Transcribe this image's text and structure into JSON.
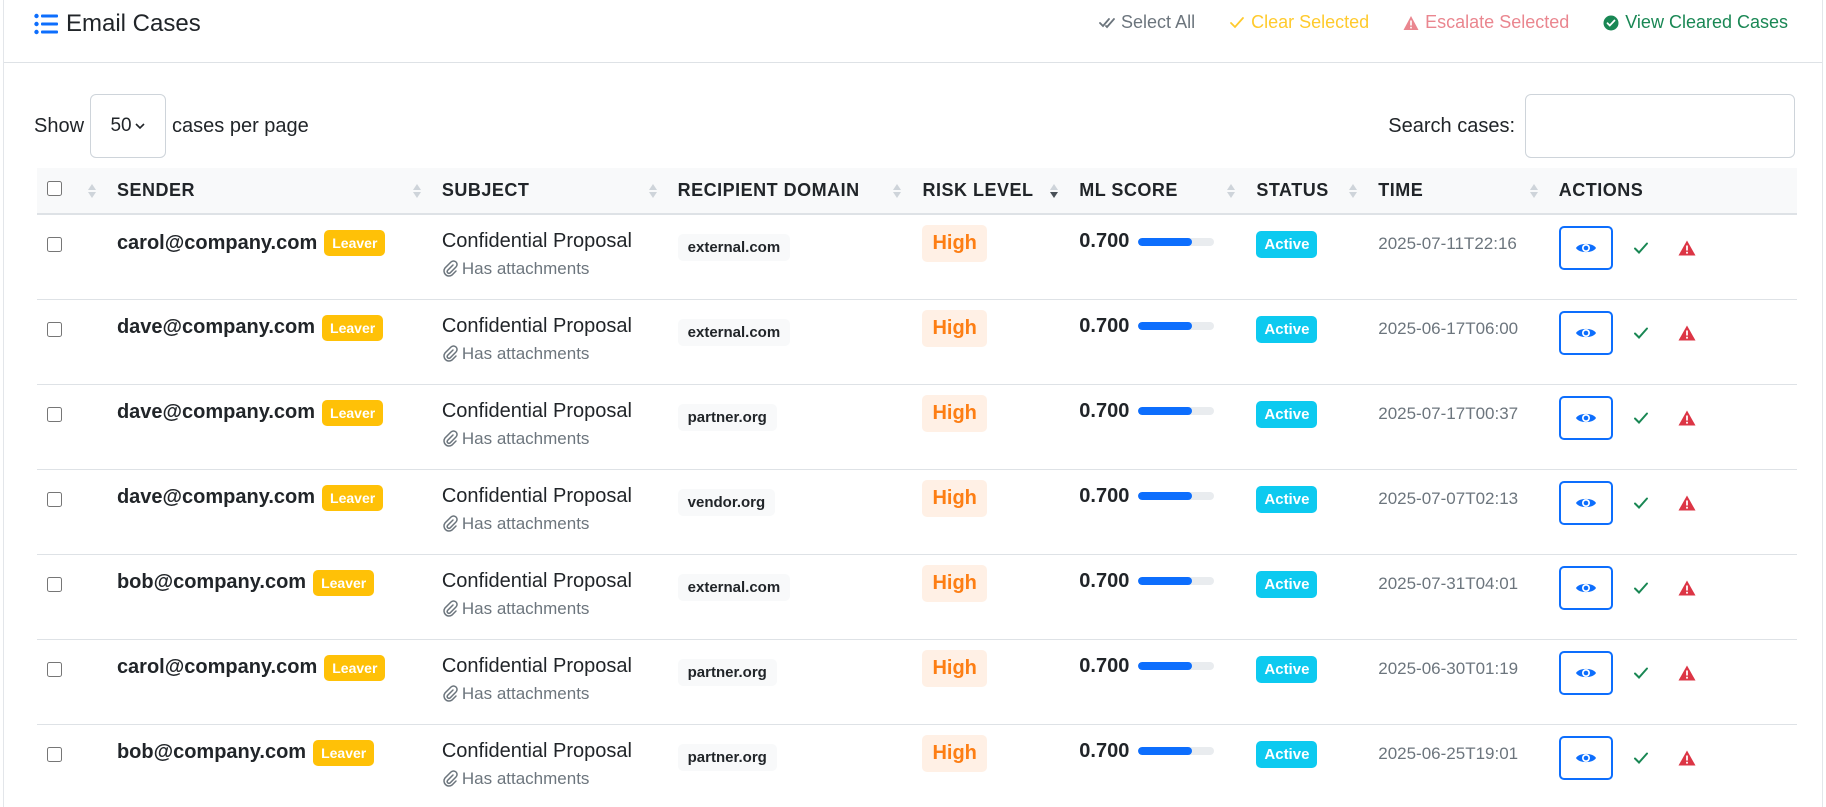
{
  "header": {
    "title": "Email Cases",
    "select_all": "Select All",
    "clear_selected": "Clear Selected",
    "escalate_selected": "Escalate Selected",
    "view_cleared": "View Cleared Cases"
  },
  "controls": {
    "show_label": "Show",
    "page_size": "50",
    "per_page_label": "cases per page",
    "search_label": "Search cases:",
    "search_value": ""
  },
  "columns": {
    "sender": "SENDER",
    "subject": "SUBJECT",
    "recipient_domain": "RECIPIENT DOMAIN",
    "risk_level": "RISK LEVEL",
    "ml_score": "ML SCORE",
    "status": "STATUS",
    "time": "TIME",
    "actions": "ACTIONS"
  },
  "sort": {
    "column": "risk_level",
    "direction": "desc"
  },
  "colors": {
    "primary": "#0d6efd",
    "leaver_badge": "#ffc107",
    "risk_high_text": "#fd7e14",
    "status_active": "#0dcaf0",
    "success": "#198754",
    "danger": "#dc3545"
  },
  "rows": [
    {
      "sender": "carol@company.com",
      "badge": "Leaver",
      "subject": "Confidential Proposal",
      "attachment_note": "Has attachments",
      "domain": "external.com",
      "risk": "High",
      "score": "0.700",
      "score_fraction": 0.7,
      "status": "Active",
      "time": "2025-07-11T22:16"
    },
    {
      "sender": "dave@company.com",
      "badge": "Leaver",
      "subject": "Confidential Proposal",
      "attachment_note": "Has attachments",
      "domain": "external.com",
      "risk": "High",
      "score": "0.700",
      "score_fraction": 0.7,
      "status": "Active",
      "time": "2025-06-17T06:00"
    },
    {
      "sender": "dave@company.com",
      "badge": "Leaver",
      "subject": "Confidential Proposal",
      "attachment_note": "Has attachments",
      "domain": "partner.org",
      "risk": "High",
      "score": "0.700",
      "score_fraction": 0.7,
      "status": "Active",
      "time": "2025-07-17T00:37"
    },
    {
      "sender": "dave@company.com",
      "badge": "Leaver",
      "subject": "Confidential Proposal",
      "attachment_note": "Has attachments",
      "domain": "vendor.org",
      "risk": "High",
      "score": "0.700",
      "score_fraction": 0.7,
      "status": "Active",
      "time": "2025-07-07T02:13"
    },
    {
      "sender": "bob@company.com",
      "badge": "Leaver",
      "subject": "Confidential Proposal",
      "attachment_note": "Has attachments",
      "domain": "external.com",
      "risk": "High",
      "score": "0.700",
      "score_fraction": 0.7,
      "status": "Active",
      "time": "2025-07-31T04:01"
    },
    {
      "sender": "carol@company.com",
      "badge": "Leaver",
      "subject": "Confidential Proposal",
      "attachment_note": "Has attachments",
      "domain": "partner.org",
      "risk": "High",
      "score": "0.700",
      "score_fraction": 0.7,
      "status": "Active",
      "time": "2025-06-30T01:19"
    },
    {
      "sender": "bob@company.com",
      "badge": "Leaver",
      "subject": "Confidential Proposal",
      "attachment_note": "Has attachments",
      "domain": "partner.org",
      "risk": "High",
      "score": "0.700",
      "score_fraction": 0.7,
      "status": "Active",
      "time": "2025-06-25T19:01"
    }
  ]
}
